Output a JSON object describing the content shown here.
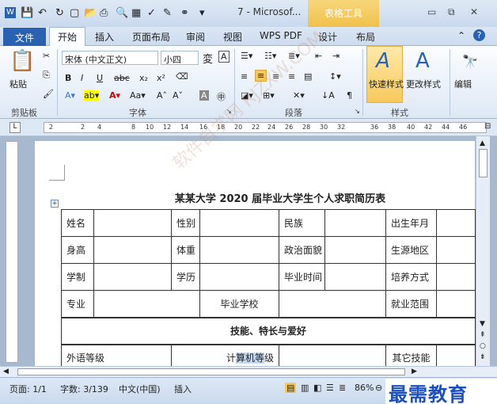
{
  "titlebar": {
    "title": "7 - Microsof...",
    "context_tab": "表格工具"
  },
  "tabs": [
    "文件",
    "开始",
    "插入",
    "页面布局",
    "审阅",
    "视图",
    "WPS PDF",
    "设计",
    "布局"
  ],
  "ribbon": {
    "clipboard": {
      "paste": "粘贴",
      "label": "剪贴板"
    },
    "font": {
      "font_name": "宋体 (中文正文)",
      "font_size": "小四",
      "label": "字体"
    },
    "paragraph": {
      "label": "段落"
    },
    "styles": {
      "quick": "快速样式",
      "change": "更改样式",
      "label": "样式"
    },
    "editing": {
      "label": "编辑"
    }
  },
  "ruler_marks": [
    "2",
    "2",
    "4",
    "8",
    "10",
    "12",
    "14",
    "16",
    "18",
    "20",
    "22",
    "24",
    "26",
    "28",
    "30",
    "32",
    "36",
    "38",
    "40",
    "42",
    "44",
    "46"
  ],
  "doc": {
    "title": "某某大学 2020 届毕业大学生个人求职简历表",
    "row1": [
      "姓名",
      "",
      "性别",
      "",
      "民族",
      "",
      "出生年月",
      ""
    ],
    "row2": [
      "身高",
      "",
      "体重",
      "",
      "政治面貌",
      "",
      "生源地区",
      ""
    ],
    "row3": [
      "学制",
      "",
      "学历",
      "",
      "毕业时间",
      "",
      "培养方式",
      ""
    ],
    "row4": [
      "专业",
      "",
      "毕业学校",
      "",
      "就业范围",
      ""
    ],
    "section": "技能、特长与爱好",
    "row6_a": "外语等级",
    "row6_b_pre": "计",
    "row6_b_hl": "算机等",
    "row6_b_post": "级",
    "row6_c": "其它技能"
  },
  "status": {
    "page": "页面: 1/1",
    "words": "字数: 3/139",
    "lang": "中文(中国)",
    "mode": "插入",
    "zoom": "86%"
  },
  "watermark_logo": "最需教育",
  "watermark_diag": "软件自学网 RJZXW.COM"
}
